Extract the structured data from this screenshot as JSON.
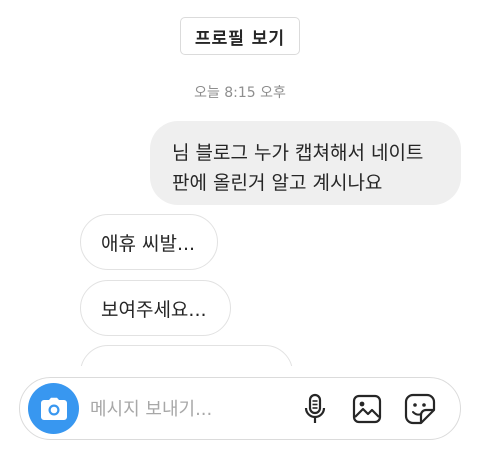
{
  "header": {
    "profile_button_label": "프로필 보기"
  },
  "thread": {
    "timestamp": "오늘 8:15 오후",
    "messages": [
      {
        "direction": "outgoing",
        "lines": [
          "님 블로그 누가 캡쳐해서 네이트",
          "판에 올린거 알고 계시나요"
        ]
      },
      {
        "direction": "incoming",
        "text": "애휴 씨발..."
      },
      {
        "direction": "incoming",
        "text": "보여주세요..."
      },
      {
        "direction": "incoming",
        "text": "",
        "partially_hidden": true
      }
    ]
  },
  "composer": {
    "placeholder": "메시지 보내기...",
    "value": "",
    "icons": [
      "camera-icon",
      "microphone-icon",
      "gallery-icon",
      "sticker-icon"
    ],
    "accent_color": "#3897f0"
  }
}
